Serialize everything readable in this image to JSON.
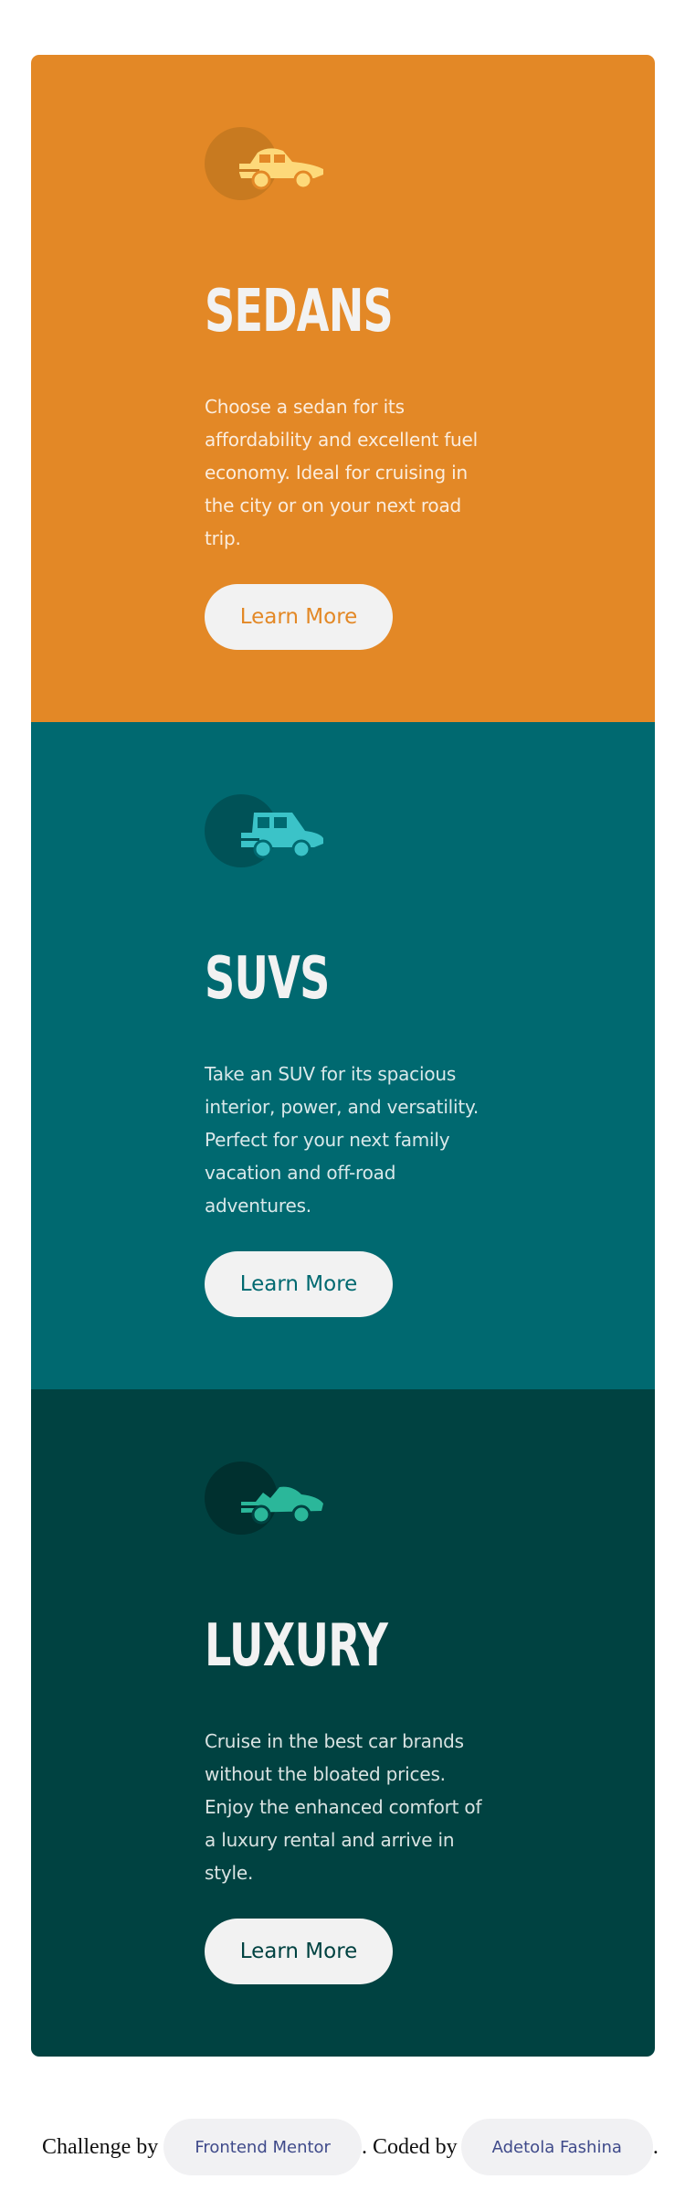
{
  "colors": {
    "sedans_bg": "#e38826",
    "suvs_bg": "#006970",
    "luxury_bg": "#004241",
    "button_bg": "#f2f2f2",
    "heading": "#f2f2f2"
  },
  "cards": [
    {
      "icon": "sedan-car-icon",
      "title": "SEDANS",
      "description": "Choose a sedan for its affordability and excellent fuel economy. Ideal for cruising in the city or on your next road trip.",
      "button_label": "Learn More"
    },
    {
      "icon": "suv-car-icon",
      "title": "SUVS",
      "description": "Take an SUV for its spacious interior, power, and versatility. Perfect for your next family vacation and off-road adventures.",
      "button_label": "Learn More"
    },
    {
      "icon": "luxury-car-icon",
      "title": "LUXURY",
      "description": "Cruise in the best car brands without the bloated prices. Enjoy the enhanced comfort of a luxury rental and arrive in style.",
      "button_label": "Learn More"
    }
  ],
  "footer": {
    "challenge_text": "Challenge by",
    "challenge_link": "Frontend Mentor",
    "coded_text": ". Coded by",
    "author_link": "Adetola Fashina",
    "end_text": "."
  }
}
